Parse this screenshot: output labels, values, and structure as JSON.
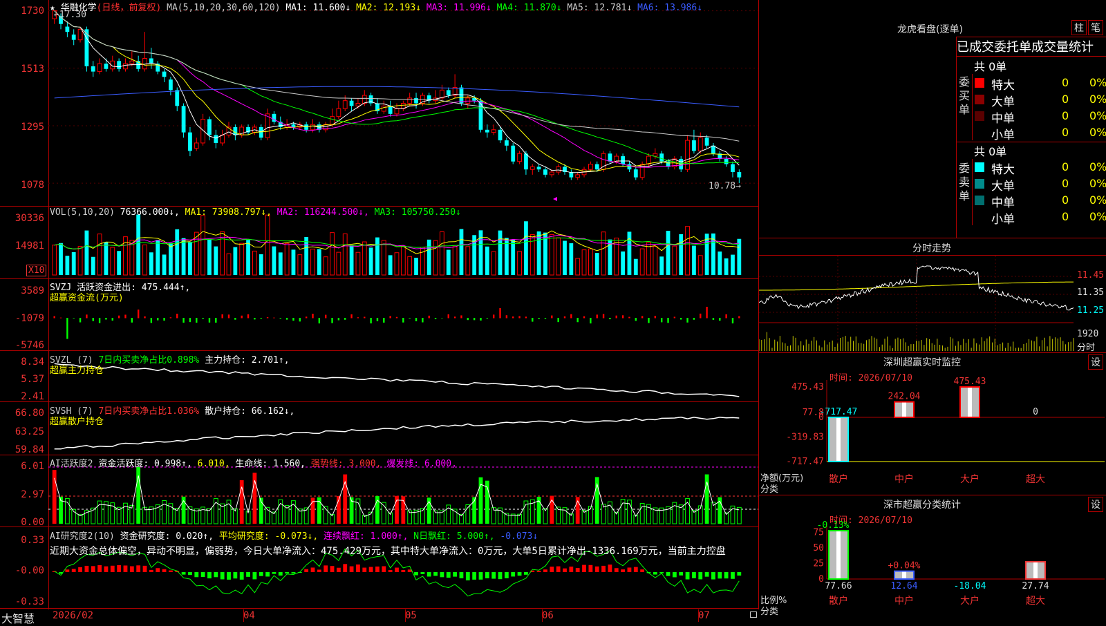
{
  "main": {
    "title": "华融化学",
    "title_sub": "(日线，前复权)",
    "star": "★",
    "ma_line": {
      "head": "MA(5,10,20,30,60,120)",
      "items": [
        {
          "text": "MA1: 11.600↓",
          "color": "#ffffff"
        },
        {
          "text": "MA2: 12.193↓",
          "color": "#ffff00"
        },
        {
          "text": "MA3: 11.996↓",
          "color": "#ff00ff"
        },
        {
          "text": "MA4: 11.870↓",
          "color": "#00ff00"
        },
        {
          "text": "MA5: 12.781↓",
          "color": "#cccccc"
        },
        {
          "text": "MA6: 13.986↓",
          "color": "#3a5cff"
        }
      ]
    },
    "high_label": "17.30",
    "low_label": "10.78",
    "price_ticks": [
      "1730",
      "1513",
      "1295",
      "1078"
    ],
    "date_labels": [
      "2026/02",
      "04",
      "05",
      "06",
      "07"
    ],
    "brand": "大智慧",
    "candles": [
      {
        "o": 17.0,
        "c": 17.3,
        "h": 17.3,
        "l": 16.8
      },
      {
        "o": 17.1,
        "c": 16.8,
        "h": 17.2,
        "l": 16.6
      },
      {
        "o": 16.7,
        "c": 16.5,
        "h": 16.9,
        "l": 16.3
      },
      {
        "o": 16.4,
        "c": 16.2,
        "h": 16.6,
        "l": 16.0
      },
      {
        "o": 16.2,
        "c": 16.6,
        "h": 16.7,
        "l": 16.1
      },
      {
        "o": 16.6,
        "c": 15.2,
        "h": 16.7,
        "l": 15.0
      },
      {
        "o": 15.2,
        "c": 15.0,
        "h": 15.4,
        "l": 14.8
      },
      {
        "o": 15.0,
        "c": 15.3,
        "h": 15.5,
        "l": 14.9
      },
      {
        "o": 15.3,
        "c": 15.1,
        "h": 15.5,
        "l": 15.0
      },
      {
        "o": 15.1,
        "c": 15.4,
        "h": 15.6,
        "l": 15.0
      },
      {
        "o": 15.4,
        "c": 15.1,
        "h": 15.5,
        "l": 15.0
      },
      {
        "o": 15.1,
        "c": 15.3,
        "h": 15.5,
        "l": 15.0
      },
      {
        "o": 15.3,
        "c": 15.4,
        "h": 15.8,
        "l": 15.2
      },
      {
        "o": 15.4,
        "c": 15.1,
        "h": 15.6,
        "l": 15.0
      },
      {
        "o": 15.1,
        "c": 15.5,
        "h": 16.5,
        "l": 15.0
      },
      {
        "o": 15.5,
        "c": 15.3,
        "h": 15.9,
        "l": 15.1
      },
      {
        "o": 15.3,
        "c": 15.0,
        "h": 15.4,
        "l": 14.9
      },
      {
        "o": 15.0,
        "c": 14.8,
        "h": 15.1,
        "l": 14.6
      },
      {
        "o": 14.7,
        "c": 14.3,
        "h": 14.8,
        "l": 14.1
      },
      {
        "o": 14.3,
        "c": 13.7,
        "h": 14.4,
        "l": 13.5
      },
      {
        "o": 13.7,
        "c": 12.7,
        "h": 13.8,
        "l": 12.5
      },
      {
        "o": 12.7,
        "c": 12.0,
        "h": 12.9,
        "l": 11.8
      },
      {
        "o": 12.1,
        "c": 12.3,
        "h": 12.5,
        "l": 12.0
      },
      {
        "o": 12.3,
        "c": 13.2,
        "h": 13.4,
        "l": 12.2
      },
      {
        "o": 13.2,
        "c": 12.6,
        "h": 13.3,
        "l": 12.4
      },
      {
        "o": 12.6,
        "c": 12.3,
        "h": 12.8,
        "l": 12.1
      },
      {
        "o": 12.3,
        "c": 12.6,
        "h": 12.8,
        "l": 12.2
      },
      {
        "o": 12.6,
        "c": 12.9,
        "h": 13.1,
        "l": 12.5
      },
      {
        "o": 12.9,
        "c": 12.6,
        "h": 13.0,
        "l": 12.4
      },
      {
        "o": 12.6,
        "c": 12.9,
        "h": 13.0,
        "l": 12.5
      },
      {
        "o": 12.9,
        "c": 12.7,
        "h": 13.0,
        "l": 12.6
      },
      {
        "o": 12.7,
        "c": 12.9,
        "h": 13.0,
        "l": 12.6
      },
      {
        "o": 12.9,
        "c": 12.5,
        "h": 13.0,
        "l": 12.4
      },
      {
        "o": 12.5,
        "c": 13.4,
        "h": 13.6,
        "l": 12.4
      },
      {
        "o": 13.4,
        "c": 13.1,
        "h": 13.5,
        "l": 13.0
      },
      {
        "o": 13.1,
        "c": 12.9,
        "h": 13.3,
        "l": 12.8
      },
      {
        "o": 12.9,
        "c": 13.0,
        "h": 13.2,
        "l": 12.8
      },
      {
        "o": 13.0,
        "c": 12.9,
        "h": 13.1,
        "l": 12.8
      },
      {
        "o": 12.9,
        "c": 13.0,
        "h": 13.1,
        "l": 12.8
      },
      {
        "o": 13.0,
        "c": 12.8,
        "h": 13.1,
        "l": 12.7
      },
      {
        "o": 12.8,
        "c": 13.0,
        "h": 13.2,
        "l": 12.7
      },
      {
        "o": 13.0,
        "c": 12.8,
        "h": 13.1,
        "l": 12.7
      },
      {
        "o": 12.8,
        "c": 13.0,
        "h": 13.1,
        "l": 12.7
      },
      {
        "o": 13.0,
        "c": 13.3,
        "h": 13.6,
        "l": 12.9
      },
      {
        "o": 13.3,
        "c": 13.6,
        "h": 13.9,
        "l": 13.2
      },
      {
        "o": 13.6,
        "c": 13.9,
        "h": 14.1,
        "l": 13.5
      },
      {
        "o": 13.9,
        "c": 13.7,
        "h": 14.0,
        "l": 13.5
      },
      {
        "o": 13.7,
        "c": 13.8,
        "h": 14.0,
        "l": 13.6
      },
      {
        "o": 13.8,
        "c": 14.1,
        "h": 14.3,
        "l": 13.7
      },
      {
        "o": 14.1,
        "c": 13.8,
        "h": 14.2,
        "l": 13.7
      },
      {
        "o": 13.8,
        "c": 13.5,
        "h": 14.0,
        "l": 13.4
      },
      {
        "o": 13.5,
        "c": 13.7,
        "h": 13.9,
        "l": 13.4
      },
      {
        "o": 13.7,
        "c": 13.4,
        "h": 13.9,
        "l": 13.3
      },
      {
        "o": 13.4,
        "c": 13.6,
        "h": 13.8,
        "l": 13.3
      },
      {
        "o": 13.6,
        "c": 13.8,
        "h": 13.9,
        "l": 13.5
      },
      {
        "o": 13.8,
        "c": 14.0,
        "h": 14.2,
        "l": 13.7
      },
      {
        "o": 14.0,
        "c": 13.8,
        "h": 14.2,
        "l": 13.6
      },
      {
        "o": 13.8,
        "c": 14.1,
        "h": 14.2,
        "l": 13.7
      },
      {
        "o": 14.1,
        "c": 13.9,
        "h": 14.2,
        "l": 13.8
      },
      {
        "o": 13.9,
        "c": 14.0,
        "h": 14.3,
        "l": 13.8
      },
      {
        "o": 14.0,
        "c": 14.3,
        "h": 14.5,
        "l": 13.9
      },
      {
        "o": 14.3,
        "c": 14.1,
        "h": 14.4,
        "l": 14.0
      },
      {
        "o": 14.1,
        "c": 14.4,
        "h": 14.9,
        "l": 14.0
      },
      {
        "o": 14.4,
        "c": 13.8,
        "h": 14.5,
        "l": 13.7
      },
      {
        "o": 13.8,
        "c": 14.0,
        "h": 14.1,
        "l": 13.6
      },
      {
        "o": 14.0,
        "c": 13.9,
        "h": 14.1,
        "l": 13.8
      },
      {
        "o": 13.9,
        "c": 12.8,
        "h": 14.0,
        "l": 12.7
      },
      {
        "o": 12.8,
        "c": 12.7,
        "h": 13.0,
        "l": 12.5
      },
      {
        "o": 12.7,
        "c": 12.8,
        "h": 13.0,
        "l": 12.6
      },
      {
        "o": 12.8,
        "c": 12.4,
        "h": 12.9,
        "l": 12.3
      },
      {
        "o": 12.4,
        "c": 12.2,
        "h": 12.5,
        "l": 12.0
      },
      {
        "o": 12.2,
        "c": 11.6,
        "h": 12.3,
        "l": 11.5
      },
      {
        "o": 11.6,
        "c": 11.9,
        "h": 12.0,
        "l": 11.5
      },
      {
        "o": 11.9,
        "c": 11.3,
        "h": 12.0,
        "l": 11.1
      },
      {
        "o": 11.3,
        "c": 11.4,
        "h": 11.5,
        "l": 11.1
      },
      {
        "o": 11.4,
        "c": 11.3,
        "h": 11.5,
        "l": 11.2
      },
      {
        "o": 11.3,
        "c": 11.1,
        "h": 11.4,
        "l": 11.0
      },
      {
        "o": 11.1,
        "c": 11.2,
        "h": 11.3,
        "l": 11.0
      },
      {
        "o": 11.2,
        "c": 11.4,
        "h": 11.5,
        "l": 11.1
      },
      {
        "o": 11.4,
        "c": 11.2,
        "h": 11.5,
        "l": 11.1
      },
      {
        "o": 11.2,
        "c": 11.0,
        "h": 11.3,
        "l": 10.9
      },
      {
        "o": 11.0,
        "c": 11.1,
        "h": 11.2,
        "l": 10.9
      },
      {
        "o": 11.1,
        "c": 11.3,
        "h": 11.4,
        "l": 11.0
      },
      {
        "o": 11.3,
        "c": 11.5,
        "h": 11.6,
        "l": 11.2
      },
      {
        "o": 11.5,
        "c": 11.3,
        "h": 11.6,
        "l": 11.2
      },
      {
        "o": 11.3,
        "c": 11.9,
        "h": 12.0,
        "l": 11.2
      },
      {
        "o": 11.9,
        "c": 11.6,
        "h": 12.0,
        "l": 11.5
      },
      {
        "o": 11.6,
        "c": 11.8,
        "h": 11.9,
        "l": 11.5
      },
      {
        "o": 11.8,
        "c": 11.5,
        "h": 11.9,
        "l": 11.4
      },
      {
        "o": 11.5,
        "c": 11.3,
        "h": 11.6,
        "l": 11.2
      },
      {
        "o": 11.3,
        "c": 11.0,
        "h": 11.4,
        "l": 10.9
      },
      {
        "o": 11.0,
        "c": 11.5,
        "h": 11.6,
        "l": 10.9
      },
      {
        "o": 11.5,
        "c": 11.8,
        "h": 11.9,
        "l": 11.4
      },
      {
        "o": 11.8,
        "c": 11.9,
        "h": 12.1,
        "l": 11.7
      },
      {
        "o": 11.9,
        "c": 11.6,
        "h": 12.0,
        "l": 11.5
      },
      {
        "o": 11.6,
        "c": 11.4,
        "h": 11.7,
        "l": 11.3
      },
      {
        "o": 11.4,
        "c": 11.7,
        "h": 11.8,
        "l": 11.3
      },
      {
        "o": 11.7,
        "c": 11.3,
        "h": 11.8,
        "l": 11.2
      },
      {
        "o": 11.3,
        "c": 12.4,
        "h": 12.6,
        "l": 11.2
      },
      {
        "o": 12.4,
        "c": 12.0,
        "h": 12.8,
        "l": 11.9
      },
      {
        "o": 12.0,
        "c": 12.5,
        "h": 12.7,
        "l": 11.9
      },
      {
        "o": 12.5,
        "c": 12.2,
        "h": 12.6,
        "l": 12.1
      },
      {
        "o": 12.2,
        "c": 11.9,
        "h": 12.3,
        "l": 11.8
      },
      {
        "o": 11.9,
        "c": 11.7,
        "h": 12.0,
        "l": 11.6
      },
      {
        "o": 11.7,
        "c": 11.5,
        "h": 11.8,
        "l": 11.4
      },
      {
        "o": 11.5,
        "c": 11.2,
        "h": 11.6,
        "l": 11.0
      },
      {
        "o": 11.2,
        "c": 11.0,
        "h": 11.3,
        "l": 10.78
      }
    ]
  },
  "vol": {
    "header_head": "VOL(5,10,20)",
    "header_val": "76366.000↓,",
    "items": [
      {
        "text": "MA1: 73908.797↓,",
        "color": "#ffff00"
      },
      {
        "text": "MA2: 116244.500↓,",
        "color": "#ff00ff"
      },
      {
        "text": "MA3: 105750.250↓",
        "color": "#00ff00"
      }
    ],
    "ticks": [
      "30336",
      "14981"
    ],
    "unit": "X10"
  },
  "svzj": {
    "header": "SVZJ  活跃资金进出: 475.444↑,",
    "sub": "超赢资金流(万元)",
    "ticks": [
      "3589",
      "-1079",
      "-5746"
    ]
  },
  "svzl": {
    "header_a": "SVZL (7)",
    "header_b": "7日内买卖净占比0.898%",
    "header_c": "主力持仓: 2.701↑,",
    "sub": "超赢主力持仓",
    "ticks": [
      "8.34",
      "5.37",
      "2.41"
    ]
  },
  "svsh": {
    "header_a": "SVSH (7)",
    "header_b": "7日内买卖净占比1.036%",
    "header_c": "散户持仓: 66.162↓,",
    "sub": "超赢散户持仓",
    "ticks": [
      "66.80",
      "63.25",
      "59.84"
    ]
  },
  "ai1": {
    "header_a": "AI活跃度2",
    "header_b": "资金活跃度: 0.998↑,",
    "header_c": "6.010,",
    "header_d": "生命线: 1.560,",
    "header_e": "强势线: 3.000,",
    "header_f": "爆发线: 6.000,",
    "ticks": [
      "6.01",
      "2.97",
      "0.00"
    ]
  },
  "ai2": {
    "header_a": "AI研究度2(10)",
    "header_b": "资金研究度: 0.020↑,",
    "header_c": "平均研究度: -0.073↓,",
    "header_d": "连续飘红: 1.000↑,",
    "header_e": "N日飘红: 5.000↑,",
    "header_f": "-0.073↓",
    "comment": "近期大资金总体偏空，异动不明显，偏弱势，今日大单净流入：475.429万元，其中特大单净流入：0万元，大单5日累计净出-1336.169万元，当前主力控盘",
    "ticks": [
      "0.33",
      "-0.00",
      "-0.33"
    ]
  },
  "right": {
    "lhb_title": "龙虎看盘(逐单)",
    "btn_zhu": "柱",
    "btn_bi": "笔",
    "stat_title": "已成交委托单成交量统计",
    "buy": {
      "total": "共 0单",
      "side_label": "委买单",
      "rows": [
        {
          "name": "特大",
          "val": "0",
          "pct": "0%",
          "color": "#ff0000"
        },
        {
          "name": "大单",
          "val": "0",
          "pct": "0%",
          "color": "#8b0000"
        },
        {
          "name": "中单",
          "val": "0",
          "pct": "0%",
          "color": "#5a0000"
        },
        {
          "name": "小单",
          "val": "0",
          "pct": "0%",
          "color": "#000000"
        }
      ]
    },
    "sell": {
      "total": "共 0单",
      "side_label": "委卖单",
      "rows": [
        {
          "name": "特大",
          "val": "0",
          "pct": "0%",
          "color": "#00ffff"
        },
        {
          "name": "大单",
          "val": "0",
          "pct": "0%",
          "color": "#008b8b"
        },
        {
          "name": "中单",
          "val": "0",
          "pct": "0%",
          "color": "#006f6f"
        },
        {
          "name": "小单",
          "val": "0",
          "pct": "0%",
          "color": "#000000"
        }
      ]
    },
    "intraday": {
      "title": "分时走势",
      "ticks": [
        "11.45",
        "11.35",
        "11.25"
      ],
      "vol_label": "1920",
      "tab_label": "分时"
    },
    "monitor": {
      "title": "深圳超赢实时监控",
      "settings": "设",
      "time": "时间: 2026/07/10",
      "ticks": [
        "475.43",
        "77.8",
        "0",
        "-319.83",
        "-717.47"
      ],
      "y_label_a": "净额(万元)",
      "y_label_b": "分类",
      "bars": [
        {
          "name": "散户",
          "value": -717.47,
          "label": "-717.47"
        },
        {
          "name": "中户",
          "value": 242.04,
          "label": "242.04"
        },
        {
          "name": "大户",
          "value": 475.43,
          "label": "475.43"
        },
        {
          "name": "超大",
          "value": 0,
          "label": "0"
        }
      ]
    },
    "classify": {
      "title": "深市超赢分类统计",
      "settings": "设",
      "time": "时间: 2026/07/10",
      "ticks": [
        "75",
        "50",
        "25",
        "0"
      ],
      "y_label_a": "比例%",
      "y_label_b": "分类",
      "bars": [
        {
          "name": "散户",
          "value": 77.66,
          "label": "77.66",
          "delta": "-0.13%"
        },
        {
          "name": "中户",
          "value": 12.64,
          "label": "12.64",
          "delta": "+0.04%"
        },
        {
          "name": "大户",
          "value": 0,
          "label": "-18.04",
          "delta": ""
        },
        {
          "name": "超大",
          "value": 27.74,
          "label": "27.74",
          "delta": ""
        }
      ]
    }
  },
  "colors": {
    "up": "#ff0000",
    "down": "#00ffff",
    "grid": "#b00000",
    "ma1": "#ffffff",
    "ma2": "#ffff00",
    "ma3": "#ff00ff",
    "ma4": "#00ff00",
    "ma5": "#cccccc",
    "ma6": "#3a5cff"
  }
}
